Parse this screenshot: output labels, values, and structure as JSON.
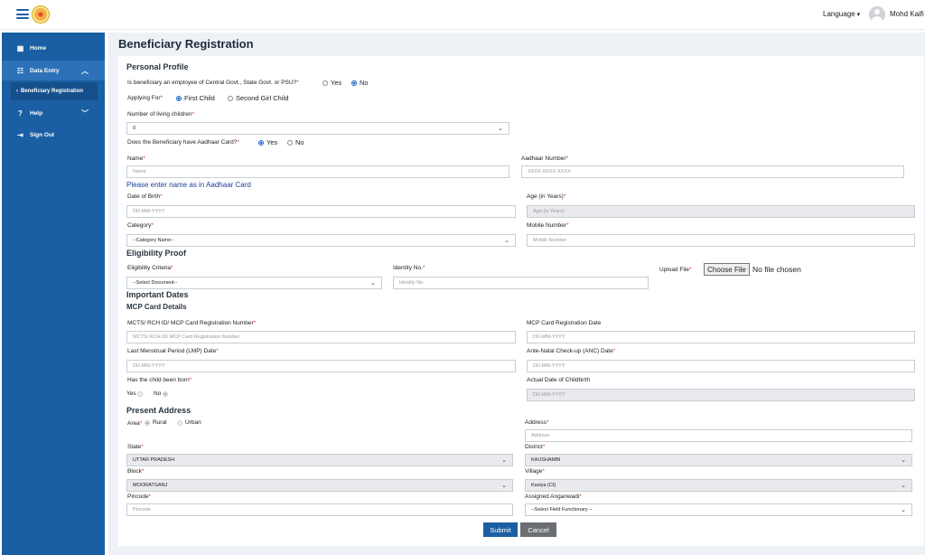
{
  "header": {
    "language_label": "Language",
    "user_name": "Mohd Kaifi"
  },
  "sidebar": {
    "home": "Home",
    "data_entry": "Data Entry",
    "beneficiary_registration": "Beneficiary Registration",
    "help": "Help",
    "sign_out": "Sign Out"
  },
  "page": {
    "title": "Beneficiary Registration"
  },
  "personal": {
    "section": "Personal Profile",
    "employee_q": "Is beneficiary an employee of Central Govt., State Govt. or PSU?",
    "yes": "Yes",
    "no": "No",
    "applying_for": "Applying For",
    "first_child": "First Child",
    "second_girl": "Second Girl Child",
    "living_children_label": "Number of living children",
    "living_children_value": "0",
    "aadhaar_q": "Does the Beneficiary have Aadhaar Card?",
    "name_label": "Name",
    "name_placeholder": "Name",
    "name_hint": "Please enter name as in Aadhaar Card",
    "aadhaar_label": "Aadhaar Number",
    "aadhaar_placeholder": "XXXX-XXXX-XXXX",
    "dob_label": "Date of Birth",
    "dob_placeholder": "DD-MM-YYYY",
    "age_label": "Age (in Years)",
    "age_placeholder": "Age (in Years)",
    "category_label": "Category",
    "category_value": "--Category Name--",
    "mobile_label": "Mobile Number",
    "mobile_placeholder": "Mobile Number"
  },
  "eligibility": {
    "section": "Eligibility Proof",
    "criteria_label": "Eligibility Criteria",
    "criteria_value": "--Select Document--",
    "identity_label": "Identity No.",
    "identity_placeholder": "Identity No.",
    "upload_label": "Upload File",
    "choose_file": "Choose File",
    "no_file": "No file chosen"
  },
  "dates": {
    "section": "Important Dates",
    "mcp_section": "MCP Card Details",
    "mcts_label": "MCTS/ RCH ID/ MCP Card Registration Number",
    "mcts_placeholder": "MCTS/ RCH ID/ MCP Card Registration Number",
    "mcp_date_label": "MCP Card Registration Date",
    "mcp_date_placeholder": "DD-MM-YYYY",
    "lmp_label": "Last Menstrual Period (LMP) Date",
    "lmp_placeholder": "DD-MM-YYYY",
    "anc_label": "Ante-Natal Check-up (ANC) Date",
    "anc_placeholder": "DD-MM-YYYY",
    "born_q": "Has the child been born",
    "born_yes": "Yes",
    "born_no": "No",
    "actual_label": "Actual Date of Childbirth",
    "actual_placeholder": "DD-MM-YYYY"
  },
  "address": {
    "section": "Present Address",
    "area_label": "Area",
    "rural": "Rural",
    "urban": "Urban",
    "address_label": "Address",
    "address_placeholder": "Address",
    "state_label": "State",
    "state_value": "UTTAR PRADESH",
    "district_label": "District",
    "district_value": "KAUSHAMBI",
    "block_label": "Block",
    "block_value": "MOORATGANJ",
    "village_label": "Village",
    "village_value": "Kasiya (Ct)",
    "pincode_label": "Pincode",
    "pincode_placeholder": "Pincode",
    "anganwadi_label": "Assigned Anganwadi",
    "anganwadi_value": "--Select Field Functionary --"
  },
  "actions": {
    "submit": "Submit",
    "cancel": "Cancel"
  },
  "icons": [
    "menu-icon",
    "logo-icon",
    "home-icon",
    "data-entry-icon",
    "help-icon",
    "sign-out-icon",
    "chevron-up-icon",
    "chevron-down-icon"
  ]
}
